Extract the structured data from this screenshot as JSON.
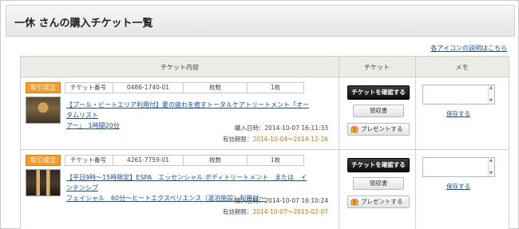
{
  "page": {
    "title": "一休 さんの購入チケット一覧",
    "help_link": "各アイコンの説明はこちら"
  },
  "table": {
    "headers": {
      "content": "チケット内容",
      "ticket": "チケット",
      "memo": "メモ"
    },
    "rows": [
      {
        "status_badge": "取引成立",
        "ticket_no_label": "チケット番号",
        "ticket_no": "0486-1740-01",
        "count_label": "枚数",
        "count": "1枚",
        "title_line1": "【プール・ビートエリア利用付】夏の疲れを癒すトータルケアトリートメント「オータムリスト",
        "title_line2": "アー」　1時間20分",
        "purchase_label": "購入日時：",
        "purchase_value": "2014-10-07 16:11:33",
        "expiry_label": "有効期限：",
        "expiry_value": "2014-10-04〜2014-12-26",
        "confirm_button": "チケットを確認する",
        "receipt_button": "領収書",
        "present_button": "プレゼントする",
        "save_link": "保存する"
      },
      {
        "status_badge": "取引成立",
        "ticket_no_label": "チケット番号",
        "ticket_no": "4261-7759-01",
        "count_label": "枚数",
        "count": "1枚",
        "title_line1": "【平日9時〜15時限定】ESPA　エッセンシャル ボディトリートメント　または　インテンシブ",
        "title_line2": "フェイシャル　60分〜ヒートエクスペリエンス（温浴施設）利用付〜",
        "purchase_label": "購入日時：",
        "purchase_value": "2014-10-07 16:10:24",
        "expiry_label": "有効期限：",
        "expiry_value": "2014-10-07〜2015-02-07",
        "confirm_button": "チケットを確認する",
        "receipt_button": "領収書",
        "present_button": "プレゼントする",
        "save_link": "保存する"
      }
    ]
  },
  "colors": {
    "badge": "#f39b2b",
    "link": "#1a4fa0",
    "header_bg": "#ecebe6",
    "expiry": "#c8780c"
  },
  "icons": {
    "present": "gift-icon",
    "memo_scroll_up": "chevron-up-icon",
    "memo_scroll_down": "chevron-down-icon"
  }
}
